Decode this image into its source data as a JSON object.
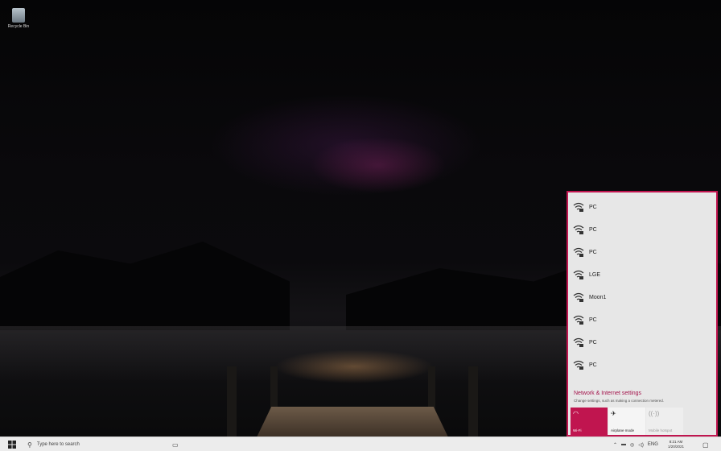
{
  "desktop": {
    "recycle_bin_label": "Recycle Bin"
  },
  "network_flyout": {
    "networks": [
      {
        "name": "PC",
        "icon": "wifi-secured-icon"
      },
      {
        "name": "PC",
        "icon": "wifi-secured-icon"
      },
      {
        "name": "PC",
        "icon": "wifi-secured-icon"
      },
      {
        "name": "LGE",
        "icon": "wifi-secured-icon"
      },
      {
        "name": "Moon1",
        "icon": "wifi-secured-icon"
      },
      {
        "name": "PC",
        "icon": "wifi-secured-icon"
      },
      {
        "name": "PC",
        "icon": "wifi-secured-icon"
      },
      {
        "name": "PC",
        "icon": "wifi-secured-icon"
      }
    ],
    "settings_link": "Network & Internet settings",
    "settings_desc": "Change settings, such as making a connection metered.",
    "tiles": {
      "wifi": "Wi-Fi",
      "airplane": "Airplane mode",
      "hotspot": "Mobile hotspot"
    },
    "accent_color": "#c0154f"
  },
  "taskbar": {
    "search_placeholder": "Type here to search",
    "language": "ENG",
    "time": "8:21 AM",
    "date": "1/20/2021"
  }
}
